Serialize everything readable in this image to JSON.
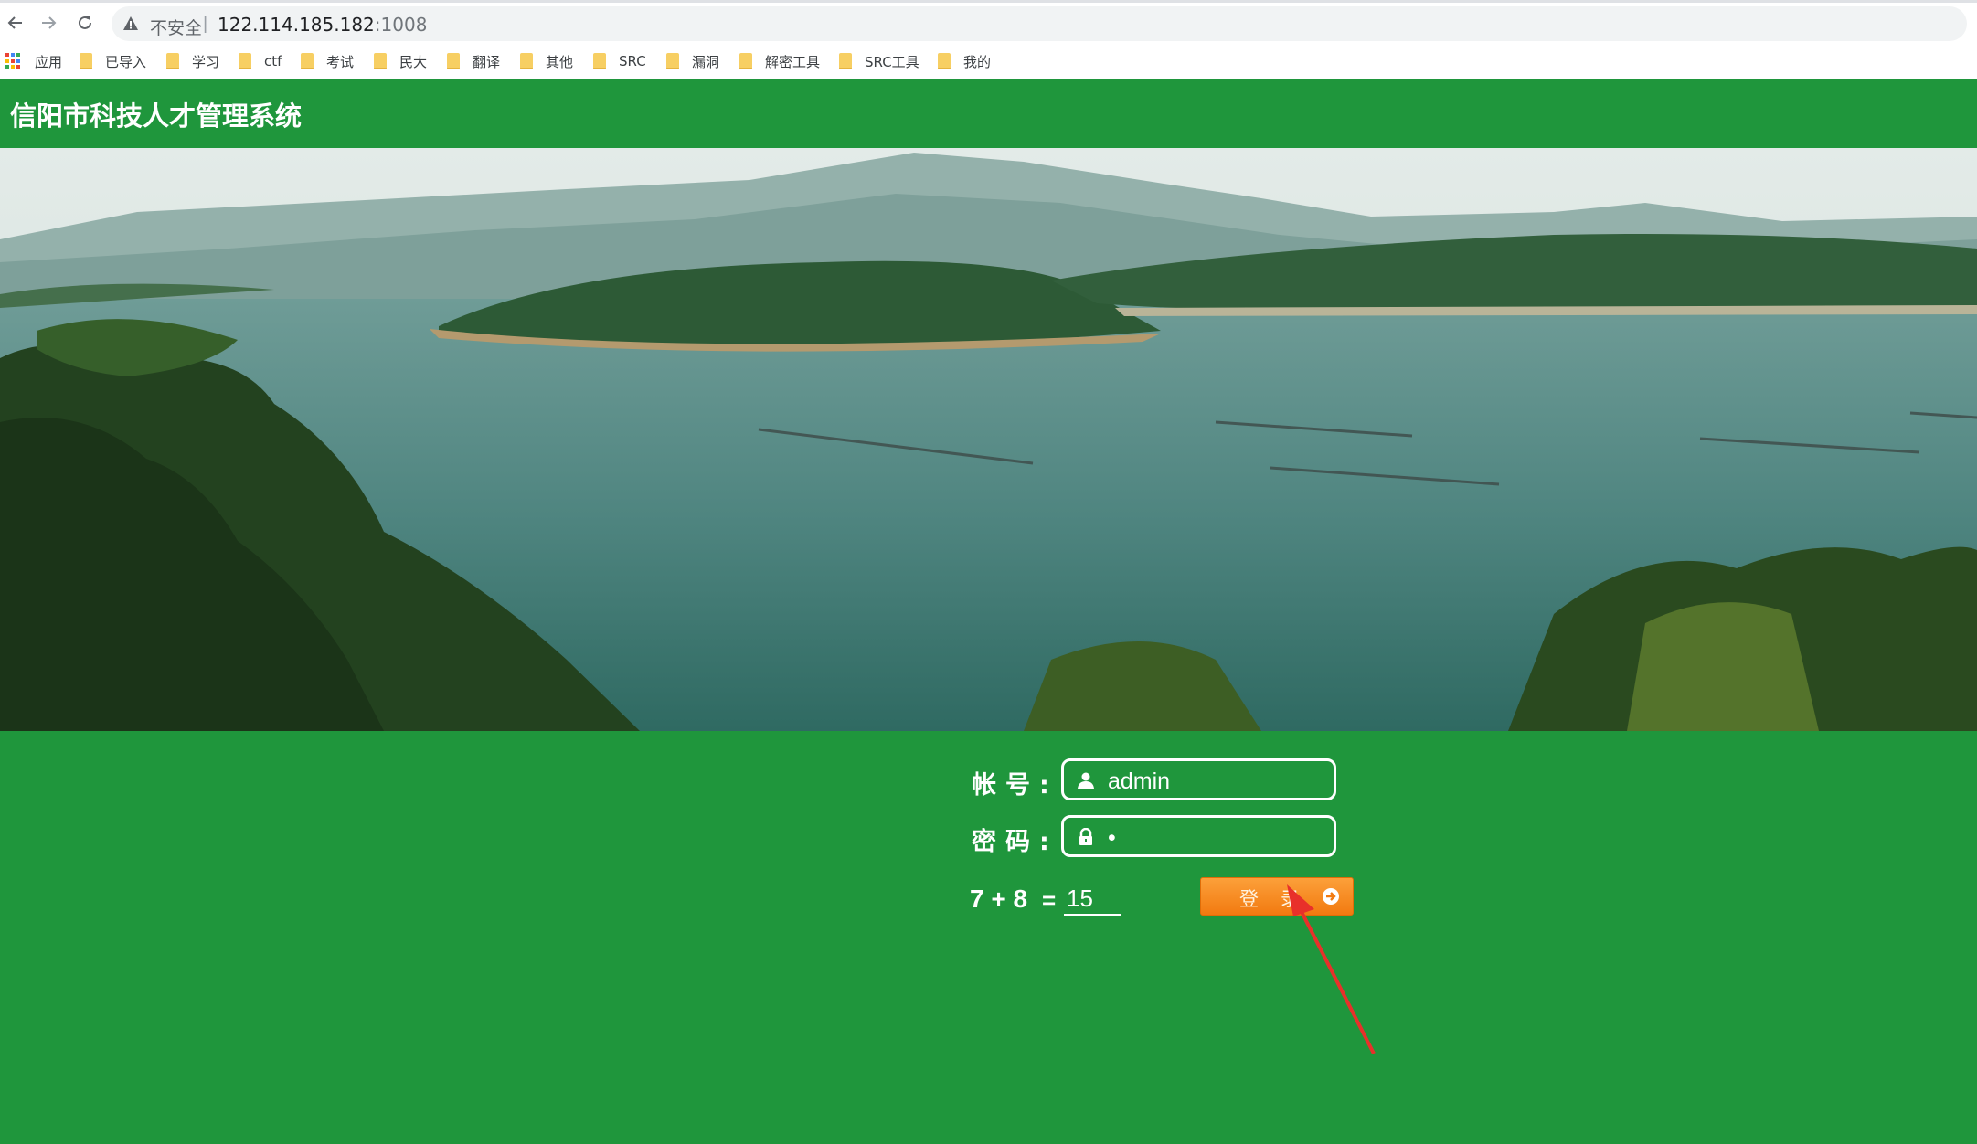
{
  "browser": {
    "back_icon": "arrow-left-icon",
    "forward_icon": "arrow-right-icon",
    "reload_icon": "reload-icon",
    "security_label": "不安全",
    "separator": "|",
    "url_host": "122.114.185.182",
    "url_port": ":1008"
  },
  "bookmarks": [
    {
      "label": "应用",
      "icon": "apps-grid-icon"
    },
    {
      "label": "已导入",
      "icon": "folder-icon"
    },
    {
      "label": "学习",
      "icon": "folder-icon"
    },
    {
      "label": "ctf",
      "icon": "folder-icon"
    },
    {
      "label": "考试",
      "icon": "folder-icon"
    },
    {
      "label": "民大",
      "icon": "folder-icon"
    },
    {
      "label": "翻译",
      "icon": "folder-icon"
    },
    {
      "label": "其他",
      "icon": "folder-icon"
    },
    {
      "label": "SRC",
      "icon": "folder-icon"
    },
    {
      "label": "漏洞",
      "icon": "folder-icon"
    },
    {
      "label": "解密工具",
      "icon": "folder-icon"
    },
    {
      "label": "SRC工具",
      "icon": "folder-icon"
    },
    {
      "label": "我的",
      "icon": "folder-icon"
    }
  ],
  "site": {
    "title": "信阳市科技人才管理系统",
    "brand_color": "#1f963c"
  },
  "login": {
    "account_label": "帐号:",
    "account_value": "admin",
    "account_icon": "user-icon",
    "password_label": "密码:",
    "password_value": "•",
    "password_icon": "lock-icon",
    "captcha_question": "7 + 8",
    "captcha_equals": "=",
    "captcha_answer": "15",
    "submit_label": "登录",
    "submit_icon": "arrow-right-circle-icon",
    "submit_color": "#f68a1f"
  },
  "annotation": {
    "type": "red-arrow",
    "target": "login-button",
    "color": "#e8302a"
  }
}
